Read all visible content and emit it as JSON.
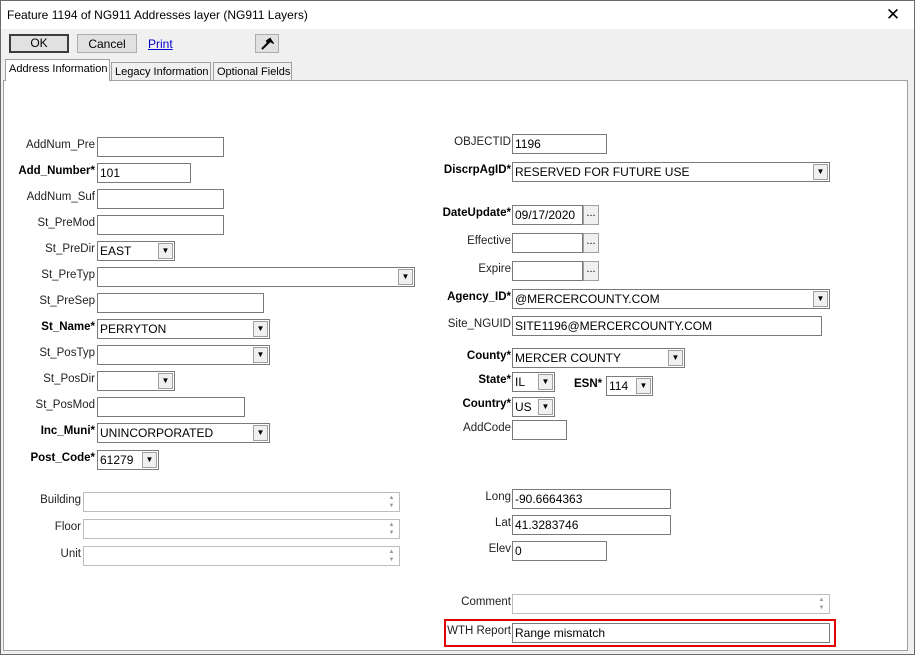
{
  "window": {
    "title": "Feature 1194 of NG911 Addresses layer  (NG911 Layers)"
  },
  "toolbar": {
    "ok_label": "OK",
    "cancel_label": "Cancel",
    "print_label": "Print"
  },
  "tabs": [
    "Address Information",
    "Legacy Information",
    "Optional Fields"
  ],
  "left_fields": [
    {
      "label": "AddNum_Pre",
      "value": ""
    },
    {
      "label": "Add_Number*",
      "value": "101"
    },
    {
      "label": "AddNum_Suf",
      "value": ""
    },
    {
      "label": "St_PreMod",
      "value": ""
    },
    {
      "label": "St_PreDir",
      "value": "EAST"
    },
    {
      "label": "St_PreTyp",
      "value": ""
    },
    {
      "label": "St_PreSep",
      "value": ""
    },
    {
      "label": "St_Name*",
      "value": "PERRYTON"
    },
    {
      "label": "St_PosTyp",
      "value": ""
    },
    {
      "label": "St_PosDir",
      "value": ""
    },
    {
      "label": "St_PosMod",
      "value": ""
    },
    {
      "label": "Inc_Muni*",
      "value": "UNINCORPORATED"
    },
    {
      "label": "Post_Code*",
      "value": "61279"
    }
  ],
  "left_lower": [
    {
      "label": "Building",
      "value": ""
    },
    {
      "label": "Floor",
      "value": ""
    },
    {
      "label": "Unit",
      "value": ""
    }
  ],
  "right_fields": [
    {
      "label": "OBJECTID",
      "value": "1196"
    },
    {
      "label": "DiscrpAgID*",
      "value": "RESERVED FOR FUTURE USE"
    },
    {
      "label": "DateUpdate*",
      "value": "09/17/2020"
    },
    {
      "label": "Effective",
      "value": ""
    },
    {
      "label": "Expire",
      "value": ""
    },
    {
      "label": "Agency_ID*",
      "value": "@MERCERCOUNTY.COM"
    },
    {
      "label": "Site_NGUID",
      "value": "SITE1196@MERCERCOUNTY.COM"
    },
    {
      "label": "County*",
      "value": "MERCER COUNTY"
    },
    {
      "label": "State*",
      "value": "IL"
    },
    {
      "label": "ESN*",
      "value": "114"
    },
    {
      "label": "Country*",
      "value": "US"
    },
    {
      "label": "AddCode",
      "value": ""
    }
  ],
  "coords": [
    {
      "label": "Long",
      "value": "-90.6664363"
    },
    {
      "label": "Lat",
      "value": "41.3283746"
    },
    {
      "label": "Elev",
      "value": "0"
    }
  ],
  "comment": {
    "label": "Comment",
    "value": ""
  },
  "wth_report": {
    "label": "WTH Report",
    "value": "Range mismatch"
  },
  "icons": {
    "close": "close-icon",
    "tool": "wrench-icon",
    "dropdown": "chevron-down-icon",
    "ellipsis": "ellipsis-icon"
  },
  "colors": {
    "highlight": "#e00000",
    "link": "#0000cc"
  }
}
